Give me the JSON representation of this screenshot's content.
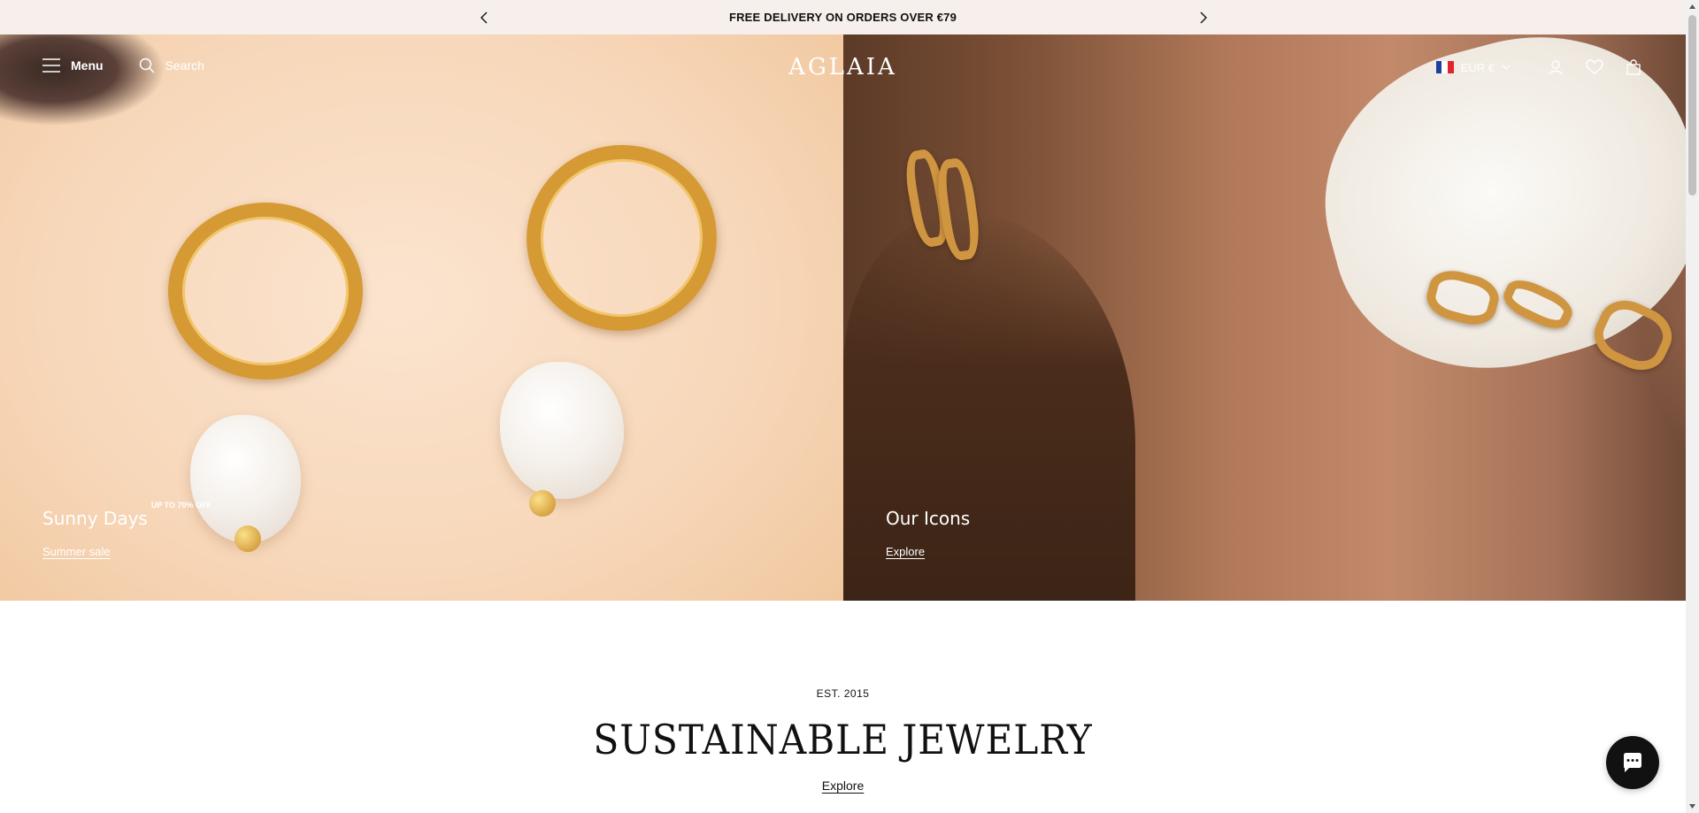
{
  "announcement": {
    "text": "FREE DELIVERY ON ORDERS OVER €79"
  },
  "header": {
    "menu_label": "Menu",
    "search_label": "Search",
    "logo": "AGLAIA",
    "currency": "EUR €"
  },
  "hero": {
    "left": {
      "title": "Sunny Days",
      "badge": "UP TO 70% OFF",
      "link": "Summer sale"
    },
    "right": {
      "title": "Our Icons",
      "link": "Explore"
    }
  },
  "intro": {
    "eyebrow": "EST. 2015",
    "headline": "SUSTAINABLE JEWELRY",
    "link": "Explore"
  },
  "colors": {
    "announcement_bg": "#f6efeb",
    "chat_bg": "#111111"
  }
}
